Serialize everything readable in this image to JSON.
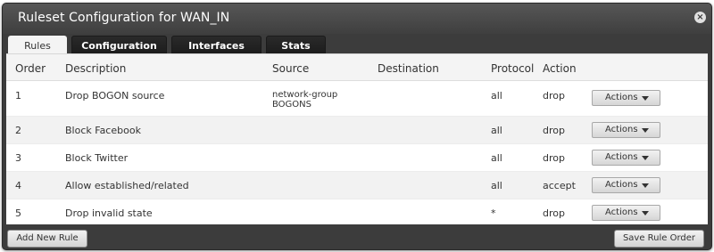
{
  "dialog": {
    "title": "Ruleset Configuration for WAN_IN",
    "close_icon": "×"
  },
  "tabs": [
    {
      "label": "Rules",
      "active": true
    },
    {
      "label": "Configuration",
      "active": false
    },
    {
      "label": "Interfaces",
      "active": false
    },
    {
      "label": "Stats",
      "active": false
    }
  ],
  "table": {
    "headers": {
      "order": "Order",
      "description": "Description",
      "source": "Source",
      "destination": "Destination",
      "protocol": "Protocol",
      "action": "Action"
    },
    "rows": [
      {
        "order": "1",
        "description": "Drop BOGON source",
        "source_line1": "network-group",
        "source_line2": "BOGONS",
        "destination": "",
        "protocol": "all",
        "action": "drop",
        "button": "Actions"
      },
      {
        "order": "2",
        "description": "Block Facebook",
        "source_line1": "",
        "source_line2": "",
        "destination": "",
        "protocol": "all",
        "action": "drop",
        "button": "Actions"
      },
      {
        "order": "3",
        "description": "Block Twitter",
        "source_line1": "",
        "source_line2": "",
        "destination": "",
        "protocol": "all",
        "action": "drop",
        "button": "Actions"
      },
      {
        "order": "4",
        "description": "Allow established/related",
        "source_line1": "",
        "source_line2": "",
        "destination": "",
        "protocol": "all",
        "action": "accept",
        "button": "Actions"
      },
      {
        "order": "5",
        "description": "Drop invalid state",
        "source_line1": "",
        "source_line2": "",
        "destination": "",
        "protocol": "*",
        "action": "drop",
        "button": "Actions"
      }
    ]
  },
  "footer": {
    "add_label": "Add New Rule",
    "save_order_label": "Save Rule Order"
  }
}
